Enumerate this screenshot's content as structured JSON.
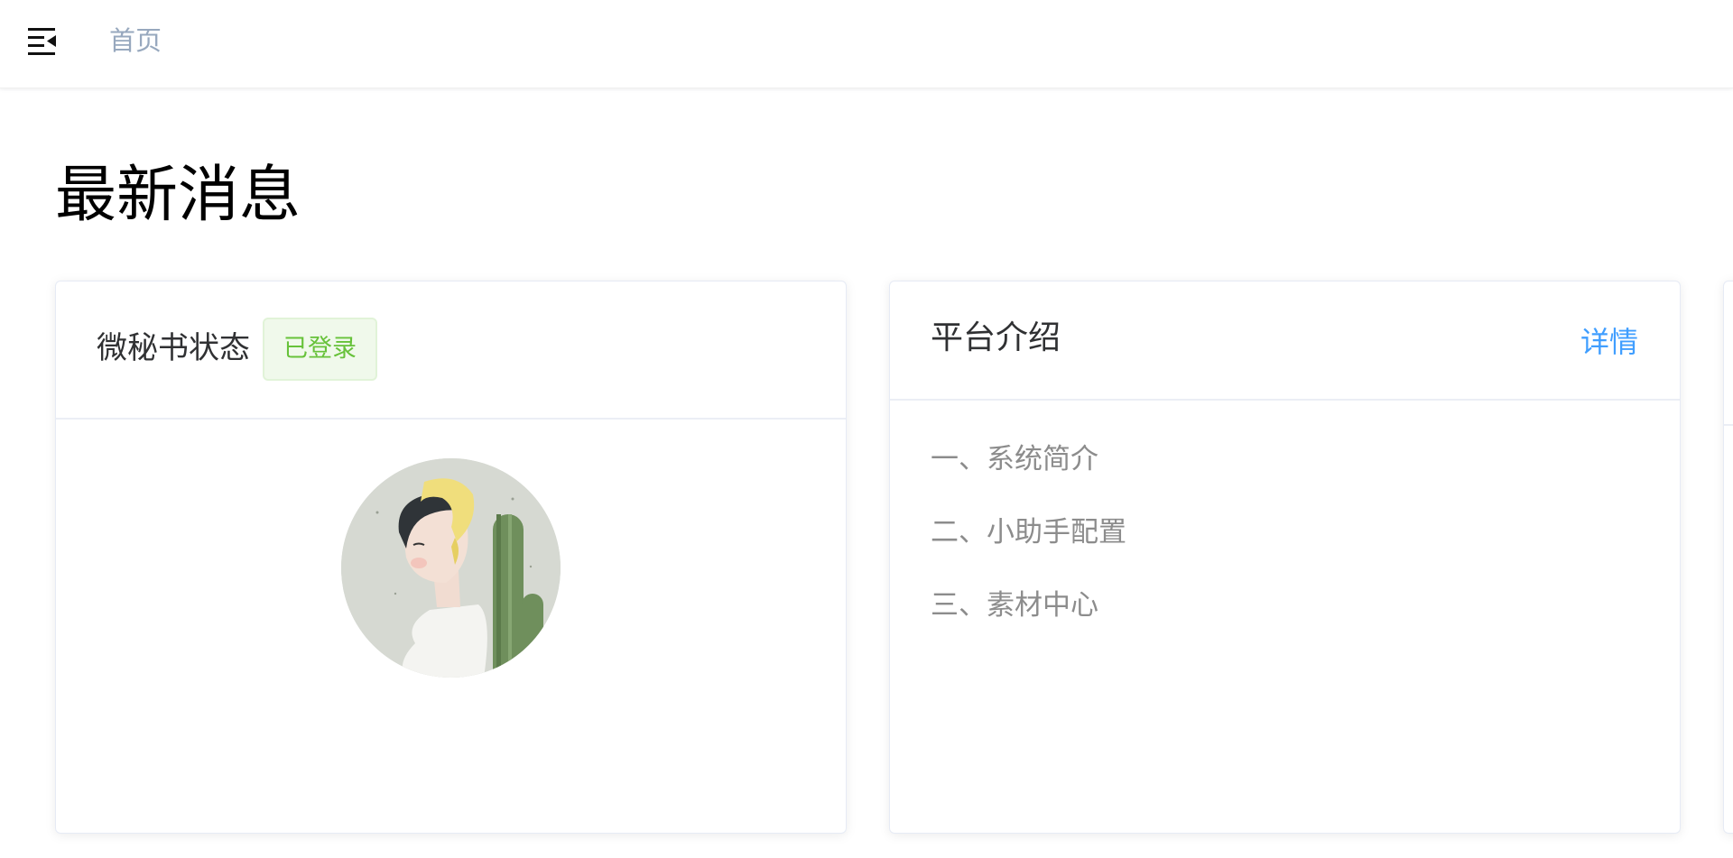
{
  "header": {
    "breadcrumb": "首页"
  },
  "page": {
    "title": "最新消息"
  },
  "assistant_card": {
    "title": "微秘书状态",
    "status_tag": "已登录",
    "status_color": "#67c23a"
  },
  "platform_card": {
    "title": "平台介绍",
    "details_link": "详情",
    "items": [
      {
        "label": "一、系统简介"
      },
      {
        "label": "二、小助手配置"
      },
      {
        "label": "三、素材中心"
      }
    ]
  },
  "colors": {
    "link": "#409eff",
    "breadcrumb": "#97a8be",
    "muted_text": "#8c8c8c"
  }
}
